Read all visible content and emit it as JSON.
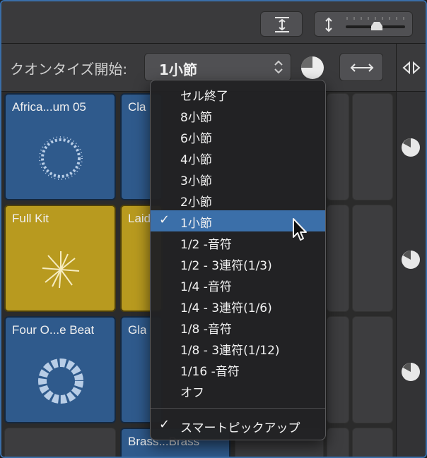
{
  "quantize": {
    "label": "クオンタイズ開始:",
    "selected_value": "1小節"
  },
  "cells": [
    {
      "title": "Africa...um 05"
    },
    {
      "title": "Cla"
    },
    {
      "title": "Full Kit"
    },
    {
      "title": "Laid"
    },
    {
      "title": "Four O...e Beat"
    },
    {
      "title": "Gla"
    },
    {
      "title": "Brass...Brass"
    }
  ],
  "menu": {
    "items": [
      {
        "label": "セル終了",
        "checked": false
      },
      {
        "label": "8小節",
        "checked": false
      },
      {
        "label": "6小節",
        "checked": false
      },
      {
        "label": "4小節",
        "checked": false
      },
      {
        "label": "3小節",
        "checked": false
      },
      {
        "label": "2小節",
        "checked": false
      },
      {
        "label": "1小節",
        "checked": true
      },
      {
        "label": "1/2 -音符",
        "checked": false
      },
      {
        "label": "1/2 - 3連符(1/3)",
        "checked": false
      },
      {
        "label": "1/4 -音符",
        "checked": false
      },
      {
        "label": "1/4 - 3連符(1/6)",
        "checked": false
      },
      {
        "label": "1/8 -音符",
        "checked": false
      },
      {
        "label": "1/8 - 3連符(1/12)",
        "checked": false
      },
      {
        "label": "1/16 -音符",
        "checked": false
      },
      {
        "label": "オフ",
        "checked": false
      }
    ],
    "smart_pickup": {
      "label": "スマートピックアップ",
      "checked": true
    }
  },
  "checkmark": "✓",
  "colors": {
    "accent_blue": "#3b6fa9",
    "cell_blue": "#2f5a8c",
    "cell_yellow": "#b89a1f"
  },
  "icons": {
    "fit": "fit-height-icon",
    "zoom": "vertical-zoom-icon",
    "quantize_pie": "quantize-pie-icon",
    "stretch": "horizontal-stretch-icon",
    "collapse": "collapse-arrows-icon"
  }
}
